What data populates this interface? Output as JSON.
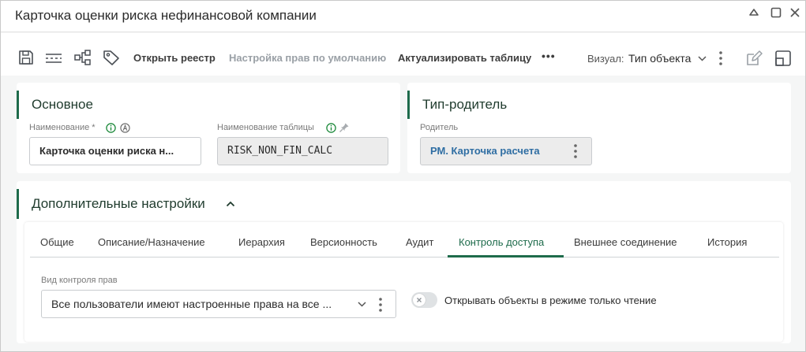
{
  "window": {
    "title": "Карточка оценки риска нефинансовой компании"
  },
  "toolbar": {
    "open_registry": "Открыть реестр",
    "default_rights": "Настройка прав по умолчанию",
    "refresh_table": "Актуализировать таблицу",
    "more": "•••",
    "visual_label": "Визуал:",
    "visual_value": "Тип объекта"
  },
  "main_card": {
    "title": "Основное",
    "name_label": "Наименование *",
    "name_value": "Карточка оценки риска н...",
    "table_name_label": "Наименование таблицы",
    "table_name_value": "RISK_NON_FIN_CALC"
  },
  "parent_card": {
    "title": "Тип-родитель",
    "parent_label": "Родитель",
    "parent_value": "РМ. Карточка расчета"
  },
  "extra": {
    "title": "Дополнительные настройки",
    "tabs": [
      "Общие",
      "Описание/Назначение",
      "Иерархия",
      "Версионность",
      "Аудит",
      "Контроль доступа",
      "Внешнее соединение",
      "История"
    ],
    "active_tab": "Контроль доступа",
    "access_label": "Вид контроля прав",
    "access_value": "Все пользователи имеют настроенные права на все ...",
    "readonly_toggle_label": "Открывать объекты в режиме только чтение",
    "readonly_toggle_on": false
  },
  "colors": {
    "accent": "#1e6b4b",
    "link": "#2f6ea3"
  }
}
